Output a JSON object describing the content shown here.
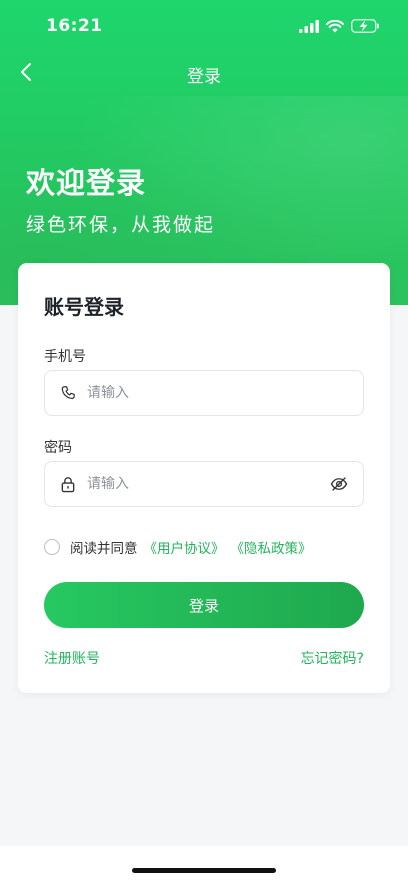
{
  "status_bar": {
    "time": "16:21"
  },
  "nav": {
    "title": "登录"
  },
  "hero": {
    "title": "欢迎登录",
    "subtitle": "绿色环保，从我做起"
  },
  "card": {
    "title": "账号登录",
    "phone": {
      "label": "手机号",
      "placeholder": "请输入",
      "value": ""
    },
    "password": {
      "label": "密码",
      "placeholder": "请输入",
      "value": ""
    },
    "agreement": {
      "text": "阅读并同意",
      "user_agreement": "《用户协议》",
      "privacy_policy": "《隐私政策》",
      "checked": false
    },
    "login_button": "登录",
    "register_link": "注册账号",
    "forgot_link": "忘记密码?"
  },
  "colors": {
    "brand_green": "#22cc64",
    "link_green": "#22b45b",
    "button_start": "#27c862",
    "button_end": "#1fa84e"
  },
  "icons": {
    "back": "chevron-left-icon",
    "phone": "phone-icon",
    "lock": "lock-icon",
    "eye": "eye-off-icon",
    "signal": "signal-icon",
    "wifi": "wifi-icon",
    "battery": "battery-charging-icon"
  }
}
